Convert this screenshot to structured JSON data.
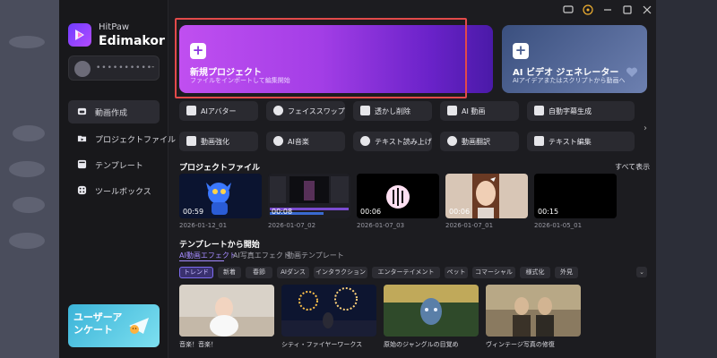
{
  "app": {
    "brand_line1": "HitPaw",
    "brand_line2": "Edimakor"
  },
  "user": {
    "name": "••••••••••",
    "suffix": "-"
  },
  "nav": [
    {
      "label": "動画作成",
      "icon": "home-icon"
    },
    {
      "label": "プロジェクトファイル",
      "icon": "folder-icon"
    },
    {
      "label": "テンプレート",
      "icon": "template-icon"
    },
    {
      "label": "ツールボックス",
      "icon": "toolbox-icon"
    }
  ],
  "banner": {
    "text": "ユーザーアンケート"
  },
  "hero": {
    "title": "新規プロジェクト",
    "subtitle": "ファイルをインポートして編集開始"
  },
  "ai_card": {
    "title": "AI ビデオ ジェネレーター",
    "subtitle": "AIアイデアまたはスクリプトから動画へ"
  },
  "tools": [
    {
      "label": "AIアバター",
      "icon": "avatar-icon"
    },
    {
      "label": "フェイススワップ",
      "icon": "face-swap-icon"
    },
    {
      "label": "透かし削除",
      "icon": "watermark-remove-icon"
    },
    {
      "label": "AI 動画",
      "icon": "ai-video-icon"
    },
    {
      "label": "自動字幕生成",
      "icon": "cc-icon"
    },
    {
      "label": "動画強化",
      "icon": "enhance-icon"
    },
    {
      "label": "AI音楽",
      "icon": "music-icon"
    },
    {
      "label": "テキスト読み上げ",
      "icon": "text-to-speech-icon"
    },
    {
      "label": "動画翻訳",
      "icon": "translate-icon"
    },
    {
      "label": "テキスト編集",
      "icon": "text-edit-icon"
    }
  ],
  "projects": {
    "title": "プロジェクトファイル",
    "see_all": "すべて表示",
    "items": [
      {
        "duration": "00:59",
        "date": "2026-01-12_01"
      },
      {
        "duration": "00:08",
        "date": "2026-01-07_02"
      },
      {
        "duration": "00:06",
        "date": "2026-01-07_03"
      },
      {
        "duration": "00:06",
        "date": "2026-01-07_01"
      },
      {
        "duration": "00:15",
        "date": "2026-01-05_01"
      }
    ]
  },
  "templates": {
    "title": "テンプレートから開始",
    "tabs": [
      "AI動画エフェクト",
      "AI写真エフェクト",
      "動画テンプレート"
    ],
    "chips": [
      "トレンド",
      "新着",
      "春節",
      "AIダンス",
      "インタラクション",
      "エンターテイメント",
      "ペット",
      "コマーシャル",
      "様式化",
      "外見"
    ],
    "cards": [
      {
        "label": "音楽！音楽！"
      },
      {
        "label": "シティ・ファイヤーワークス"
      },
      {
        "label": "原始のジャングルの目覚め"
      },
      {
        "label": "ヴィンテージ写真の修復"
      }
    ]
  },
  "colors": {
    "accent": "#a58bff",
    "highlight_outline": "#e24a4a",
    "app_bg": "#1c1c20"
  }
}
